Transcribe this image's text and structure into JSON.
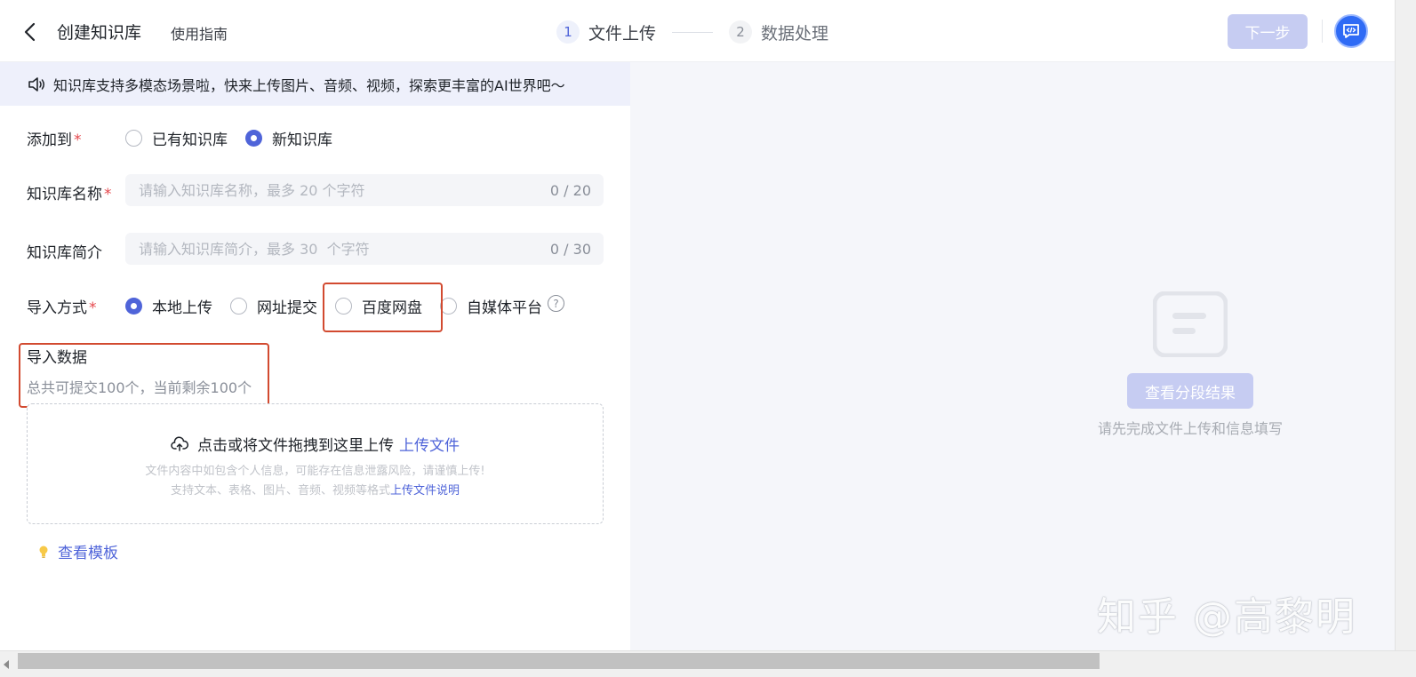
{
  "header": {
    "title": "创建知识库",
    "guide_label": "使用指南",
    "steps": [
      {
        "num": "1",
        "label": "文件上传"
      },
      {
        "num": "2",
        "label": "数据处理"
      }
    ],
    "next_label": "下一步"
  },
  "notice": {
    "text": "知识库支持多模态场景啦，快来上传图片、音频、视频，探索更丰富的AI世界吧～"
  },
  "form": {
    "add_to": {
      "label": "添加到",
      "required": "*",
      "options": [
        "已有知识库",
        "新知识库"
      ],
      "selected": "新知识库"
    },
    "name": {
      "label": "知识库名称",
      "required": "*",
      "placeholder": "请输入知识库名称，最多 20 个字符",
      "value": "",
      "counter": "0 / 20"
    },
    "intro": {
      "label": "知识库简介",
      "placeholder": "请输入知识库简介，最多 30  个字符",
      "value": "",
      "counter": "0 / 30"
    },
    "import_method": {
      "label": "导入方式",
      "required": "*",
      "options": [
        "本地上传",
        "网址提交",
        "百度网盘",
        "自媒体平台"
      ],
      "selected": "本地上传",
      "help_icon": "?"
    }
  },
  "import_data": {
    "title": "导入数据",
    "quota": "总共可提交100个，当前剩余100个"
  },
  "upload": {
    "main_text": "点击或将文件拖拽到这里上传",
    "link": "上传文件",
    "tip1": "文件内容中如包含个人信息，可能存在信息泄露风险，请谨慎上传!",
    "tip2": "支持文本、表格、图片、音频、视频等格式",
    "tip2_link": "上传文件说明"
  },
  "template_link": "查看模板",
  "right_panel": {
    "button": "查看分段结果",
    "tip": "请先完成文件上传和信息填写"
  },
  "watermark": "知乎 @高黎明",
  "colors": {
    "accent": "#4f64d9",
    "disabled_button": "#c6ccf2",
    "highlight": "#d24a30",
    "required": "#e5484d"
  }
}
